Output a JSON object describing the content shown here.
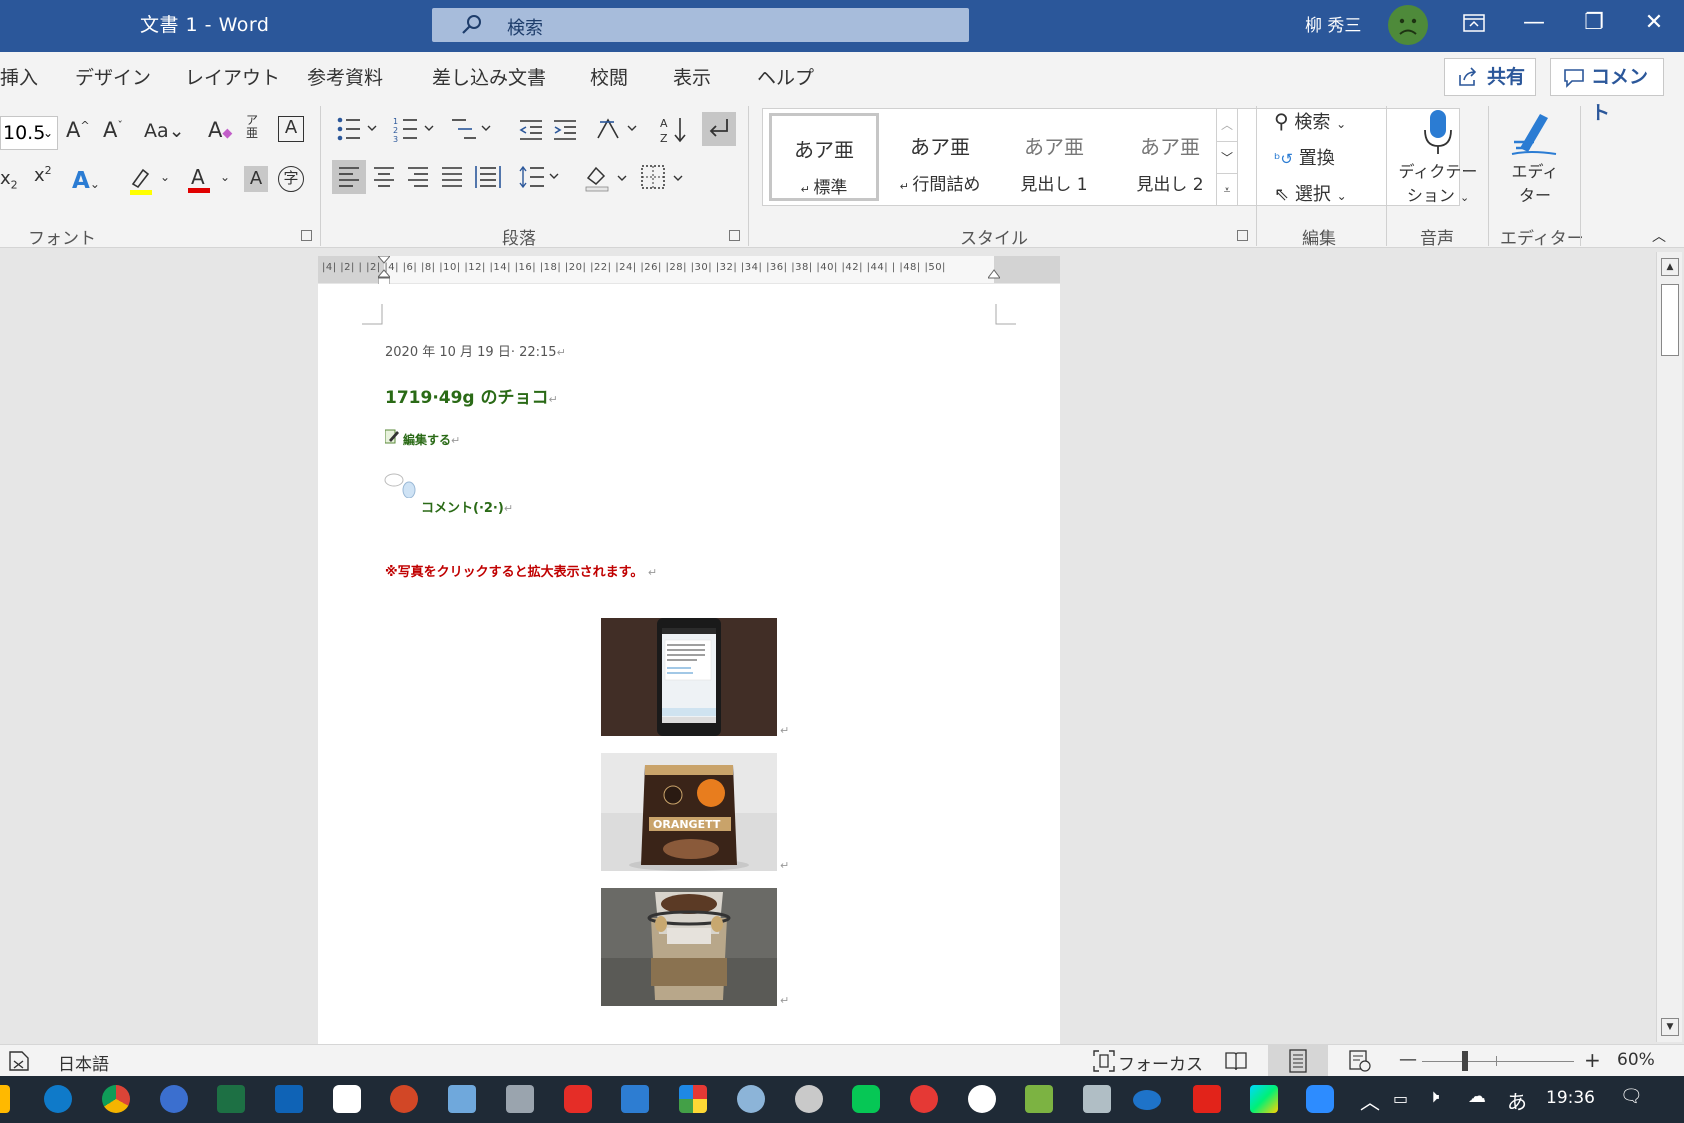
{
  "titlebar": {
    "doc_title": "文書 1  -  Word",
    "search_placeholder": "検索",
    "user_name": "柳 秀三",
    "minimize": "—",
    "restore": "❐",
    "close": "✕"
  },
  "ribbon": {
    "tabs": [
      "挿入",
      "デザイン",
      "レイアウト",
      "参考資料",
      "差し込み文書",
      "校閲",
      "表示",
      "ヘルプ"
    ],
    "share_label": "共有",
    "comment_label": "コメント",
    "font_size": "10.5",
    "groups": {
      "font": "フォント",
      "paragraph": "段落",
      "styles": "スタイル",
      "editing": "編集",
      "voice": "音声",
      "editor": "エディター"
    },
    "styles": [
      {
        "preview": "あア亜",
        "name": "標準"
      },
      {
        "preview": "あア亜",
        "name": "行間詰め"
      },
      {
        "preview": "あア亜",
        "name": "見出し 1"
      },
      {
        "preview": "あア亜",
        "name": "見出し 2"
      }
    ],
    "editing": {
      "find": "検索",
      "replace": "置換",
      "select": "選択"
    },
    "voice_label_1": "ディクテー",
    "voice_label_2": "ション",
    "editor_label_1": "エディ",
    "editor_label_2": "ター"
  },
  "ruler": {
    "ticks": "|4|  |2|     |  |2|   |4|   |6|   |8|  |10|  |12|  |14|  |16|  |18|  |20|  |22|  |24|  |26|  |28|  |30|  |32|  |34|  |36|  |38|  |40|  |42|  |44|   |   |48|  |50|"
  },
  "document": {
    "date": "2020 年 10 月 19 日· 22:15",
    "title": "1719·49g のチョコ",
    "edit_link": "編集する",
    "comment_link": "コメント(·2·)",
    "note": "※写真をクリックすると拡大表示されます。",
    "return_mark": "↵"
  },
  "statusbar": {
    "language": "日本語",
    "focus": "フォーカス",
    "zoom": "60%"
  },
  "taskbar": {
    "time": "19:36",
    "ime": "あ"
  }
}
